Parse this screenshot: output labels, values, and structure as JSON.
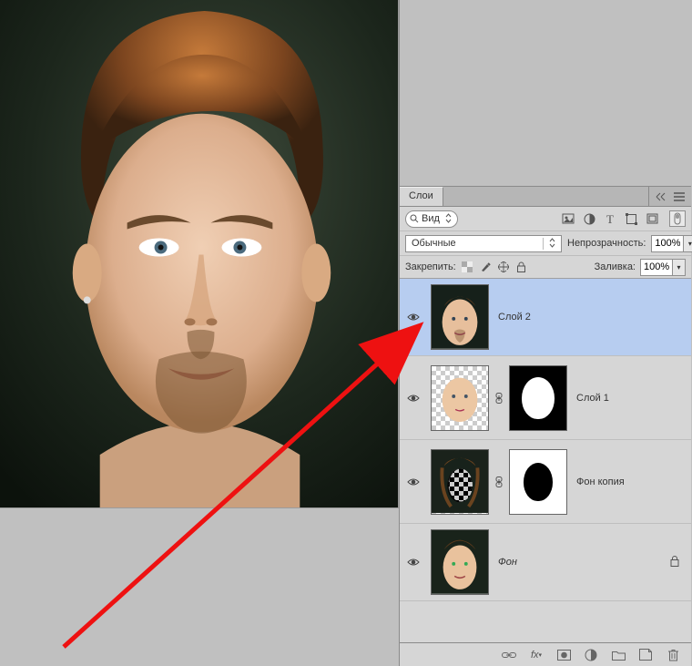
{
  "panel": {
    "title": "Слои",
    "search_label": "Вид",
    "filter_buttons": [
      "image-filter",
      "adjust-filter",
      "type-filter",
      "shape-filter",
      "smart-filter"
    ],
    "blend_mode": "Обычные",
    "opacity_label": "Непрозрачность:",
    "opacity_value": "100%",
    "lock_label": "Закрепить:",
    "fill_label": "Заливка:",
    "fill_value": "100%"
  },
  "layers": [
    {
      "name": "Слой 2",
      "visible": true,
      "selected": true,
      "has_mask": false,
      "italic": false,
      "locked": false
    },
    {
      "name": "Слой 1",
      "visible": true,
      "selected": false,
      "has_mask": true,
      "mask_bg": "black",
      "mask_fg": "white",
      "italic": false,
      "locked": false
    },
    {
      "name": "Фон копия",
      "visible": true,
      "selected": false,
      "has_mask": true,
      "mask_bg": "white",
      "mask_fg": "black",
      "italic": false,
      "locked": false
    },
    {
      "name": "Фон",
      "visible": true,
      "selected": false,
      "has_mask": false,
      "italic": true,
      "locked": true
    }
  ],
  "bottom_icons": [
    "link",
    "fx",
    "mask",
    "adjustment",
    "group",
    "new-layer",
    "trash"
  ]
}
